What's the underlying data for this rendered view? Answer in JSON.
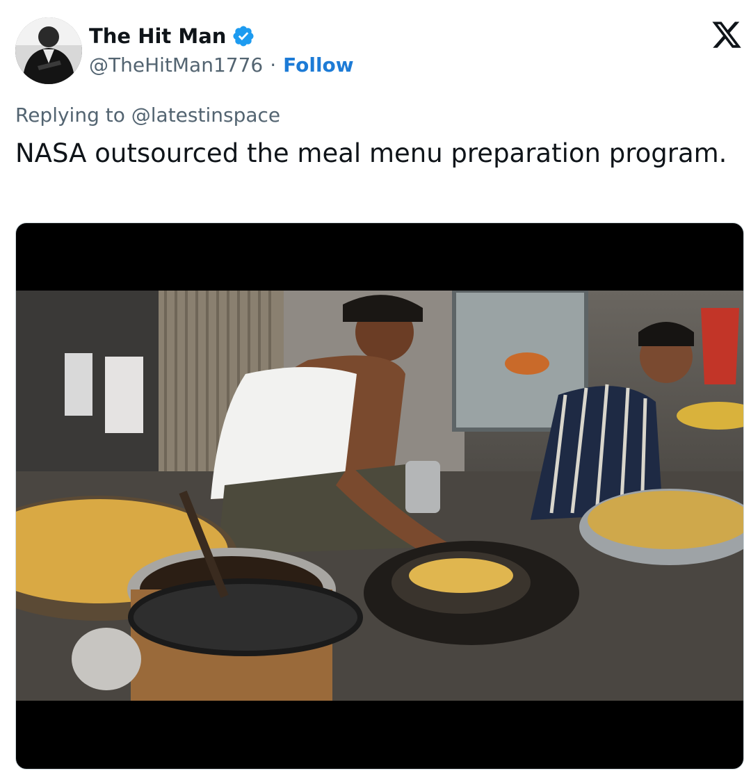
{
  "author": {
    "display_name": "The Hit Man",
    "handle": "@TheHitMan1776",
    "separator": "·",
    "follow_label": "Follow",
    "verified": true,
    "verified_color": "#1d9bf0"
  },
  "reply": {
    "text": "Replying to @latestinspace"
  },
  "tweet": {
    "text": "NASA outsourced the meal menu preparation program."
  },
  "icons": {
    "avatar": "profile-avatar",
    "verified": "verified-badge-icon",
    "brand": "x-logo-icon"
  },
  "colors": {
    "text_primary": "#0f1419",
    "text_secondary": "#536471",
    "link": "#1d7bd6",
    "media_background": "#000000"
  }
}
